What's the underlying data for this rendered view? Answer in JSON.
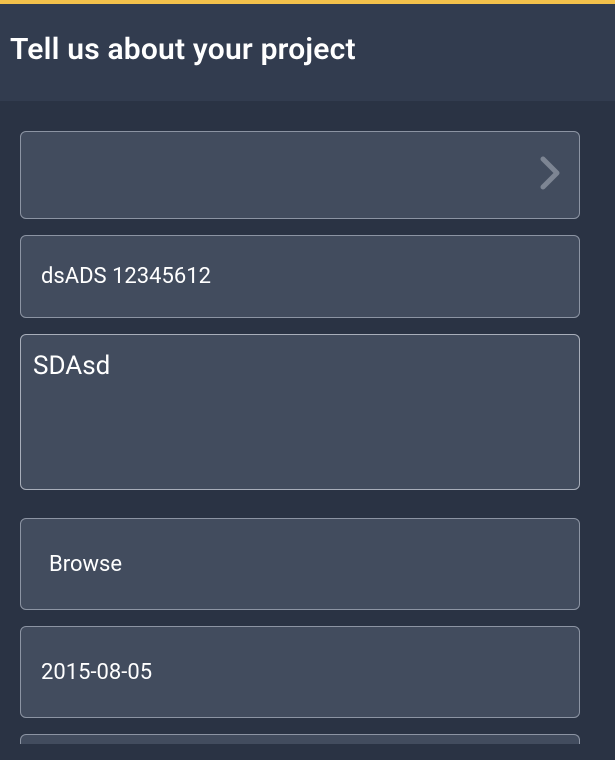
{
  "accent_color": "#f3c14b",
  "header": {
    "title": "Tell us about your project"
  },
  "form": {
    "select": {
      "value": ""
    },
    "text_input": {
      "value": "dsADS 12345612"
    },
    "description": {
      "value": "SDAsd"
    },
    "file": {
      "label": "Browse"
    },
    "date": {
      "value": "2015-08-05"
    }
  }
}
